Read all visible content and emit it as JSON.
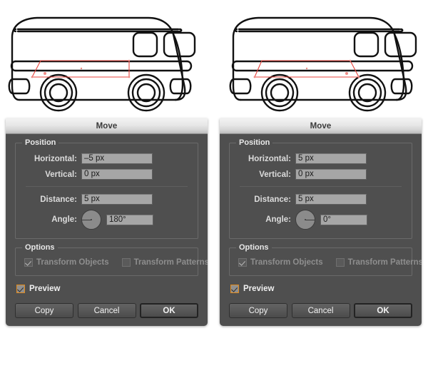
{
  "illustration": {
    "left": {
      "name": "van-outline-moved-left",
      "selection_color": "#e8433c",
      "outline_color": "#111111"
    },
    "right": {
      "name": "van-outline-moved-right",
      "selection_color": "#e8433c",
      "outline_color": "#111111"
    }
  },
  "dialogs": [
    {
      "id": "move-dialog-left",
      "title": "Move",
      "position": {
        "group_label": "Position",
        "horizontal_label": "Horizontal:",
        "horizontal_value": "–5 px",
        "vertical_label": "Vertical:",
        "vertical_value": "0 px",
        "distance_label": "Distance:",
        "distance_value": "5 px",
        "angle_label": "Angle:",
        "angle_value": "180°",
        "angle_degrees": 180
      },
      "options": {
        "group_label": "Options",
        "transform_objects_label": "Transform Objects",
        "transform_objects_checked": true,
        "transform_objects_enabled": false,
        "transform_patterns_label": "Transform Patterns",
        "transform_patterns_checked": false,
        "transform_patterns_enabled": false
      },
      "preview": {
        "label": "Preview",
        "checked": true,
        "accent_color": "#e08a1e"
      },
      "buttons": {
        "copy": "Copy",
        "cancel": "Cancel",
        "ok": "OK"
      }
    },
    {
      "id": "move-dialog-right",
      "title": "Move",
      "position": {
        "group_label": "Position",
        "horizontal_label": "Horizontal:",
        "horizontal_value": "5 px",
        "vertical_label": "Vertical:",
        "vertical_value": "0 px",
        "distance_label": "Distance:",
        "distance_value": "5 px",
        "angle_label": "Angle:",
        "angle_value": "0°",
        "angle_degrees": 0
      },
      "options": {
        "group_label": "Options",
        "transform_objects_label": "Transform Objects",
        "transform_objects_checked": true,
        "transform_objects_enabled": false,
        "transform_patterns_label": "Transform Patterns",
        "transform_patterns_checked": false,
        "transform_patterns_enabled": false
      },
      "preview": {
        "label": "Preview",
        "checked": true,
        "accent_color": "#e08a1e"
      },
      "buttons": {
        "copy": "Copy",
        "cancel": "Cancel",
        "ok": "OK"
      }
    }
  ]
}
